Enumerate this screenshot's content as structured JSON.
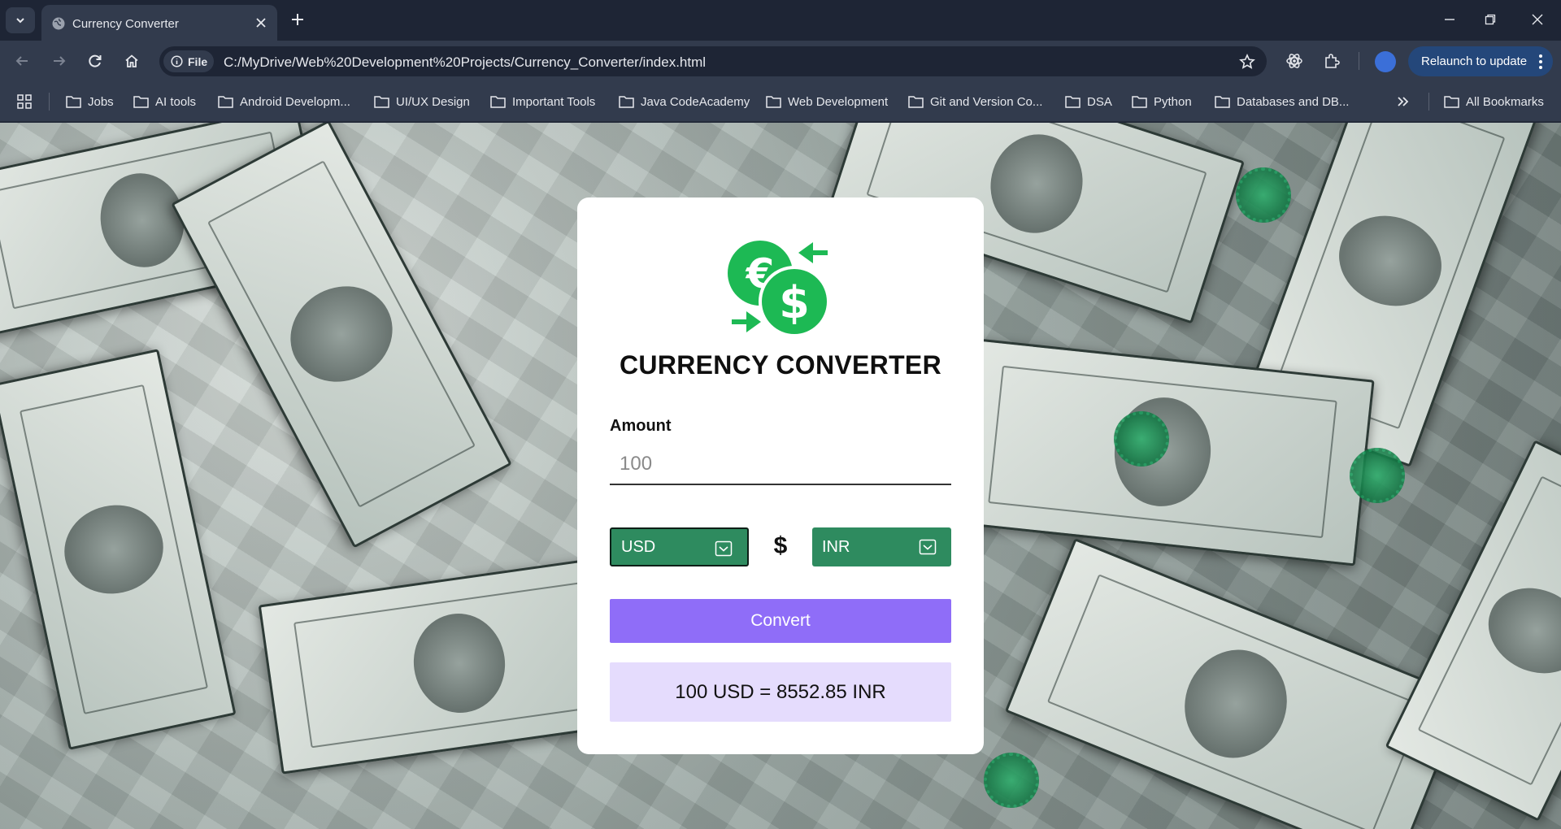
{
  "browser": {
    "tab": {
      "title": "Currency Converter",
      "favicon": "globe-icon"
    },
    "address_bar": {
      "scheme_label": "File",
      "url": "C:/MyDrive/Web%20Development%20Projects/Currency_Converter/index.html"
    },
    "relaunch_label": "Relaunch to update",
    "bookmarks": [
      {
        "label": "Jobs"
      },
      {
        "label": "AI tools"
      },
      {
        "label": "Android Developm..."
      },
      {
        "label": "UI/UX Design"
      },
      {
        "label": "Important Tools"
      },
      {
        "label": "Java CodeAcademy"
      },
      {
        "label": "Web Development"
      },
      {
        "label": "Git and Version Co..."
      },
      {
        "label": "DSA"
      },
      {
        "label": "Python"
      },
      {
        "label": "Databases and DB..."
      }
    ],
    "all_bookmarks_label": "All Bookmarks"
  },
  "app": {
    "title": "CURRENCY CONVERTER",
    "amount_label": "Amount",
    "amount_placeholder": "100",
    "from_currency": "USD",
    "to_currency": "INR",
    "swap_symbol": "$",
    "convert_label": "Convert",
    "result": "100 USD = 8552.85 INR"
  },
  "colors": {
    "accent_green": "#2e8b5f",
    "logo_green": "#1db954",
    "button_purple": "#8f6df8",
    "result_bg": "#e5dcfd"
  }
}
